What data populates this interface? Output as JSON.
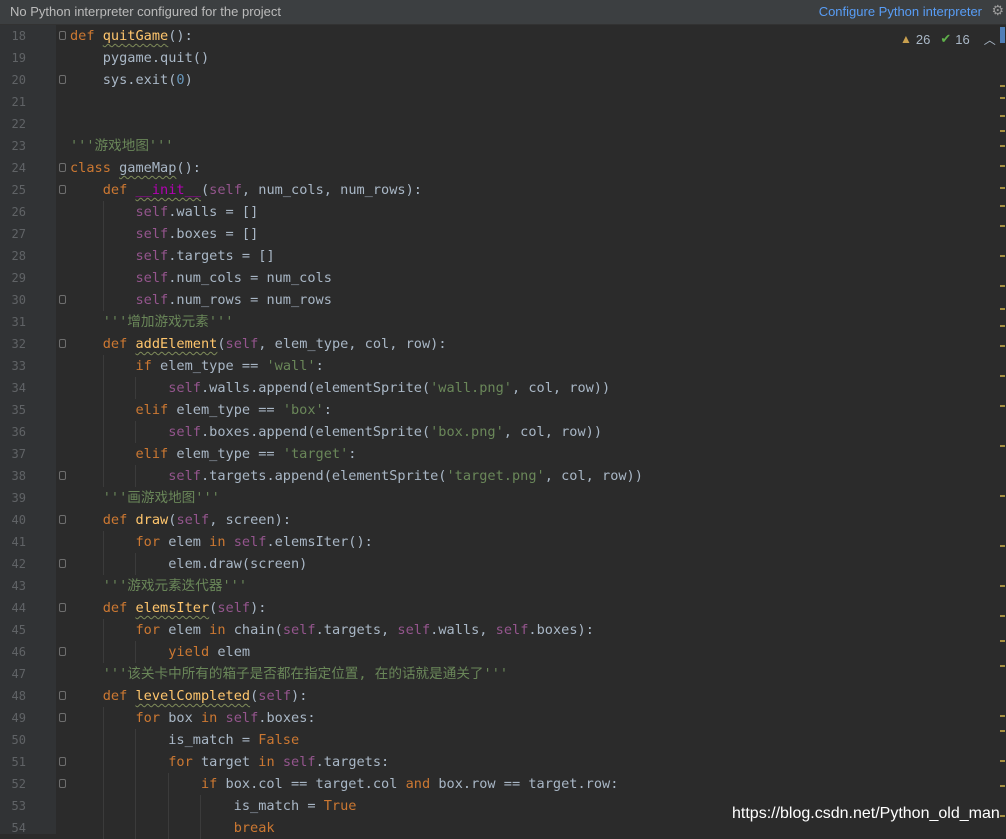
{
  "banner": {
    "message": "No Python interpreter configured for the project",
    "link": "Configure Python interpreter"
  },
  "inspections": {
    "warnings": "26",
    "weak_warnings": "16"
  },
  "icons": {
    "warning": "warning-triangle-icon",
    "check": "double-check-icon",
    "collapse": "chevron-up-icon",
    "settings": "gear-icon"
  },
  "colors": {
    "keyword": "#cc7832",
    "function": "#ffc66d",
    "self": "#94558d",
    "string": "#6a8759",
    "number": "#6897bb",
    "background": "#2b2b2b",
    "link": "#589df6"
  },
  "lines": [
    {
      "num": "18",
      "fold": true,
      "depth": 0,
      "tokens": [
        [
          "kw",
          "def "
        ],
        [
          "fn sq",
          "quitGame"
        ],
        [
          "",
          "():"
        ]
      ]
    },
    {
      "num": "19",
      "fold": false,
      "depth": 1,
      "tokens": [
        [
          "",
          "    pygame.quit()"
        ]
      ]
    },
    {
      "num": "20",
      "fold": true,
      "depth": 1,
      "tokens": [
        [
          "",
          "    sys.exit("
        ],
        [
          "num",
          "0"
        ],
        [
          "",
          ")"
        ]
      ]
    },
    {
      "num": "21",
      "fold": false,
      "depth": 0,
      "tokens": []
    },
    {
      "num": "22",
      "fold": false,
      "depth": 0,
      "tokens": []
    },
    {
      "num": "23",
      "fold": false,
      "depth": 0,
      "tokens": [
        [
          "str",
          "'''游戏地图'''"
        ]
      ]
    },
    {
      "num": "24",
      "fold": true,
      "depth": 0,
      "tokens": [
        [
          "kw",
          "class "
        ],
        [
          "sq",
          "gameMap"
        ],
        [
          "",
          "():"
        ]
      ]
    },
    {
      "num": "25",
      "fold": true,
      "depth": 1,
      "tokens": [
        [
          "",
          "    "
        ],
        [
          "kw",
          "def "
        ],
        [
          "magic sq",
          "__init__"
        ],
        [
          "",
          "("
        ],
        [
          "slf",
          "self"
        ],
        [
          "",
          ", num_cols, num_rows):"
        ]
      ]
    },
    {
      "num": "26",
      "fold": false,
      "depth": 2,
      "tokens": [
        [
          "",
          "        "
        ],
        [
          "slf",
          "self"
        ],
        [
          "",
          ".walls = []"
        ]
      ]
    },
    {
      "num": "27",
      "fold": false,
      "depth": 2,
      "tokens": [
        [
          "",
          "        "
        ],
        [
          "slf",
          "self"
        ],
        [
          "",
          ".boxes = []"
        ]
      ]
    },
    {
      "num": "28",
      "fold": false,
      "depth": 2,
      "tokens": [
        [
          "",
          "        "
        ],
        [
          "slf",
          "self"
        ],
        [
          "",
          ".targets = []"
        ]
      ]
    },
    {
      "num": "29",
      "fold": false,
      "depth": 2,
      "tokens": [
        [
          "",
          "        "
        ],
        [
          "slf",
          "self"
        ],
        [
          "",
          ".num_cols = num_cols"
        ]
      ]
    },
    {
      "num": "30",
      "fold": true,
      "depth": 2,
      "tokens": [
        [
          "",
          "        "
        ],
        [
          "slf",
          "self"
        ],
        [
          "",
          ".num_rows = num_rows"
        ]
      ]
    },
    {
      "num": "31",
      "fold": false,
      "depth": 1,
      "tokens": [
        [
          "",
          "    "
        ],
        [
          "str",
          "'''增加游戏元素'''"
        ]
      ]
    },
    {
      "num": "32",
      "fold": true,
      "depth": 1,
      "tokens": [
        [
          "",
          "    "
        ],
        [
          "kw",
          "def "
        ],
        [
          "fn sq",
          "addElement"
        ],
        [
          "",
          "("
        ],
        [
          "slf",
          "self"
        ],
        [
          "",
          ", elem_type, col, row):"
        ]
      ]
    },
    {
      "num": "33",
      "fold": false,
      "depth": 2,
      "tokens": [
        [
          "",
          "        "
        ],
        [
          "kw",
          "if "
        ],
        [
          "",
          "elem_type == "
        ],
        [
          "str",
          "'wall'"
        ],
        [
          "",
          ":"
        ]
      ]
    },
    {
      "num": "34",
      "fold": false,
      "depth": 3,
      "tokens": [
        [
          "",
          "            "
        ],
        [
          "slf",
          "self"
        ],
        [
          "",
          ".walls.append(elementSprite("
        ],
        [
          "str",
          "'wall.png'"
        ],
        [
          "",
          ", col, row))"
        ]
      ]
    },
    {
      "num": "35",
      "fold": false,
      "depth": 2,
      "tokens": [
        [
          "",
          "        "
        ],
        [
          "kw",
          "elif "
        ],
        [
          "",
          "elem_type == "
        ],
        [
          "str",
          "'box'"
        ],
        [
          "",
          ":"
        ]
      ]
    },
    {
      "num": "36",
      "fold": false,
      "depth": 3,
      "tokens": [
        [
          "",
          "            "
        ],
        [
          "slf",
          "self"
        ],
        [
          "",
          ".boxes.append(elementSprite("
        ],
        [
          "str",
          "'box.png'"
        ],
        [
          "",
          ", col, row))"
        ]
      ]
    },
    {
      "num": "37",
      "fold": false,
      "depth": 2,
      "tokens": [
        [
          "",
          "        "
        ],
        [
          "kw",
          "elif "
        ],
        [
          "",
          "elem_type == "
        ],
        [
          "str",
          "'target'"
        ],
        [
          "",
          ":"
        ]
      ]
    },
    {
      "num": "38",
      "fold": true,
      "depth": 3,
      "tokens": [
        [
          "",
          "            "
        ],
        [
          "slf",
          "self"
        ],
        [
          "",
          ".targets.append(elementSprite("
        ],
        [
          "str",
          "'target.png'"
        ],
        [
          "",
          ", col, row))"
        ]
      ]
    },
    {
      "num": "39",
      "fold": false,
      "depth": 1,
      "tokens": [
        [
          "",
          "    "
        ],
        [
          "str",
          "'''画游戏地图'''"
        ]
      ]
    },
    {
      "num": "40",
      "fold": true,
      "depth": 1,
      "tokens": [
        [
          "",
          "    "
        ],
        [
          "kw",
          "def "
        ],
        [
          "fn",
          "draw"
        ],
        [
          "",
          "("
        ],
        [
          "slf",
          "self"
        ],
        [
          "",
          ", screen):"
        ]
      ]
    },
    {
      "num": "41",
      "fold": false,
      "depth": 2,
      "tokens": [
        [
          "",
          "        "
        ],
        [
          "kw",
          "for "
        ],
        [
          "",
          "elem "
        ],
        [
          "kw",
          "in "
        ],
        [
          "slf",
          "self"
        ],
        [
          "",
          ".elemsIter():"
        ]
      ]
    },
    {
      "num": "42",
      "fold": true,
      "depth": 3,
      "tokens": [
        [
          "",
          "            elem.draw(screen)"
        ]
      ]
    },
    {
      "num": "43",
      "fold": false,
      "depth": 1,
      "tokens": [
        [
          "",
          "    "
        ],
        [
          "str",
          "'''游戏元素迭代器'''"
        ]
      ]
    },
    {
      "num": "44",
      "fold": true,
      "depth": 1,
      "tokens": [
        [
          "",
          "    "
        ],
        [
          "kw",
          "def "
        ],
        [
          "fn sq",
          "elemsIter"
        ],
        [
          "",
          "("
        ],
        [
          "slf",
          "self"
        ],
        [
          "",
          "):"
        ]
      ]
    },
    {
      "num": "45",
      "fold": false,
      "depth": 2,
      "tokens": [
        [
          "",
          "        "
        ],
        [
          "kw",
          "for "
        ],
        [
          "",
          "elem "
        ],
        [
          "kw",
          "in "
        ],
        [
          "",
          "chain("
        ],
        [
          "slf",
          "self"
        ],
        [
          "",
          ".targets, "
        ],
        [
          "slf",
          "self"
        ],
        [
          "",
          ".walls, "
        ],
        [
          "slf",
          "self"
        ],
        [
          "",
          ".boxes):"
        ]
      ]
    },
    {
      "num": "46",
      "fold": true,
      "depth": 3,
      "tokens": [
        [
          "",
          "            "
        ],
        [
          "kw",
          "yield "
        ],
        [
          "",
          "elem"
        ]
      ]
    },
    {
      "num": "47",
      "fold": false,
      "depth": 1,
      "tokens": [
        [
          "",
          "    "
        ],
        [
          "str",
          "'''该关卡中所有的箱子是否都在指定位置, 在的话就是通关了'''"
        ]
      ]
    },
    {
      "num": "48",
      "fold": true,
      "depth": 1,
      "tokens": [
        [
          "",
          "    "
        ],
        [
          "kw",
          "def "
        ],
        [
          "fn sq",
          "levelCompleted"
        ],
        [
          "",
          "("
        ],
        [
          "slf",
          "self"
        ],
        [
          "",
          "):"
        ]
      ]
    },
    {
      "num": "49",
      "fold": true,
      "depth": 2,
      "tokens": [
        [
          "",
          "        "
        ],
        [
          "kw",
          "for "
        ],
        [
          "",
          "box "
        ],
        [
          "kw",
          "in "
        ],
        [
          "slf",
          "self"
        ],
        [
          "",
          ".boxes:"
        ]
      ]
    },
    {
      "num": "50",
      "fold": false,
      "depth": 3,
      "tokens": [
        [
          "",
          "            is_match = "
        ],
        [
          "kw",
          "False"
        ]
      ]
    },
    {
      "num": "51",
      "fold": true,
      "depth": 3,
      "tokens": [
        [
          "",
          "            "
        ],
        [
          "kw",
          "for "
        ],
        [
          "",
          "target "
        ],
        [
          "kw",
          "in "
        ],
        [
          "slf",
          "self"
        ],
        [
          "",
          ".targets:"
        ]
      ]
    },
    {
      "num": "52",
      "fold": true,
      "depth": 4,
      "tokens": [
        [
          "",
          "                "
        ],
        [
          "kw",
          "if "
        ],
        [
          "",
          "box.col == target.col "
        ],
        [
          "kw",
          "and "
        ],
        [
          "",
          "box.row == target.row:"
        ]
      ]
    },
    {
      "num": "53",
      "fold": false,
      "depth": 5,
      "tokens": [
        [
          "",
          "                    is_match = "
        ],
        [
          "kw",
          "True"
        ]
      ]
    },
    {
      "num": "54",
      "fold": false,
      "depth": 5,
      "tokens": [
        [
          "",
          "                    "
        ],
        [
          "kw",
          "break"
        ]
      ]
    }
  ],
  "watermark": "https://blog.csdn.net/Python_old_man"
}
